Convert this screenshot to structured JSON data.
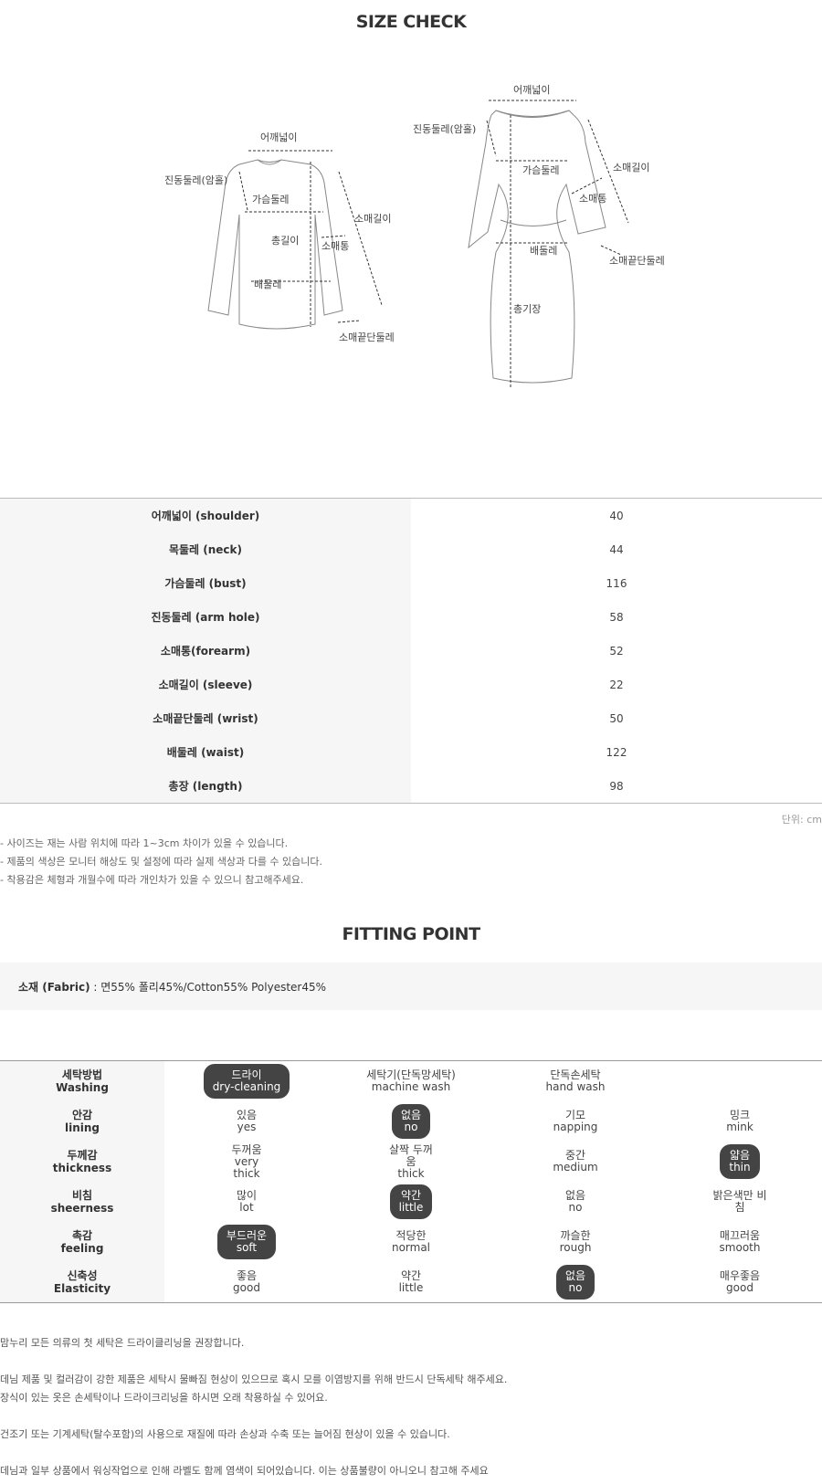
{
  "size_check": {
    "title": "SIZE CHECK",
    "top_diagram_labels": {
      "shoulder": "어깨넓이",
      "armhole": "진동둘레(암홀)",
      "bust": "가슴둘레",
      "length": "총길이",
      "forearm": "소매통",
      "sleeve": "소매길이",
      "waist": "배둘레",
      "wrist": "소매끝단둘레"
    },
    "dress_diagram_labels": {
      "shoulder": "어깨넓이",
      "armhole": "진동둘레(암홀)",
      "bust": "가슴둘레",
      "sleeve": "소매길이",
      "forearm": "소매통",
      "waist": "배둘레",
      "wrist": "소매끝단둘레",
      "length": "총기장"
    },
    "measurements": [
      {
        "label": "어깨넓이 (shoulder)",
        "value": "40"
      },
      {
        "label": "목둘레 (neck)",
        "value": "44"
      },
      {
        "label": "가슴둘레 (bust)",
        "value": "116"
      },
      {
        "label": "진동둘레 (arm hole)",
        "value": "58"
      },
      {
        "label": "소매통(forearm)",
        "value": "52"
      },
      {
        "label": "소매길이 (sleeve)",
        "value": "22"
      },
      {
        "label": "소매끝단둘레 (wrist)",
        "value": "50"
      },
      {
        "label": "배둘레 (waist)",
        "value": "122"
      },
      {
        "label": "총장 (length)",
        "value": "98"
      }
    ],
    "unit": "단위: cm",
    "notes": [
      "- 사이즈는 재는 사람 위치에 따라 1~3cm 차이가 있을 수 있습니다.",
      "- 제품의 색상은 모니터 해상도 및 설정에 따라 실제 색상과 다를 수 있습니다.",
      "- 착용감은 체형과 개월수에 따라 개인차가 있을 수 있으니 참고해주세요."
    ]
  },
  "fitting_point": {
    "title": "FITTING POINT",
    "fabric_label": "소재 (Fabric)",
    "fabric_value": " : 면55% 폴리45%/Cotton55% Polyester45%",
    "rows": [
      {
        "ko": "세탁방법",
        "en": "Washing",
        "options": [
          {
            "ko": "드라이",
            "en": "dry-cleaning",
            "selected": true
          },
          {
            "ko": "세탁기(단독망세탁)",
            "en": "machine wash",
            "selected": false
          },
          {
            "ko": "단독손세탁",
            "en": "hand wash",
            "selected": false
          },
          {
            "ko": "",
            "en": "",
            "selected": false
          }
        ]
      },
      {
        "ko": "안감",
        "en": "lining",
        "options": [
          {
            "ko": "있음",
            "en": "yes",
            "selected": false
          },
          {
            "ko": "없음",
            "en": "no",
            "selected": true
          },
          {
            "ko": "기모",
            "en": "napping",
            "selected": false
          },
          {
            "ko": "밍크",
            "en": "mink",
            "selected": false
          }
        ]
      },
      {
        "ko": "두께감",
        "en": "thickness",
        "options": [
          {
            "ko": "두꺼움",
            "en": "very\nthick",
            "selected": false
          },
          {
            "ko": "살짝 두꺼\n움",
            "en": "thick",
            "selected": false
          },
          {
            "ko": "중간",
            "en": "medium",
            "selected": false
          },
          {
            "ko": "얇음",
            "en": "thin",
            "selected": true
          }
        ]
      },
      {
        "ko": "비침",
        "en": "sheerness",
        "options": [
          {
            "ko": "많이",
            "en": "lot",
            "selected": false
          },
          {
            "ko": "약간",
            "en": "little",
            "selected": true
          },
          {
            "ko": "없음",
            "en": "no",
            "selected": false
          },
          {
            "ko": "밝은색만 비\n침",
            "en": "",
            "selected": false
          }
        ]
      },
      {
        "ko": "촉감",
        "en": "feeling",
        "options": [
          {
            "ko": "부드러운",
            "en": "soft",
            "selected": true
          },
          {
            "ko": "적당한",
            "en": "normal",
            "selected": false
          },
          {
            "ko": "까슬한",
            "en": "rough",
            "selected": false
          },
          {
            "ko": "매끄러움",
            "en": "smooth",
            "selected": false
          }
        ]
      },
      {
        "ko": "신축성",
        "en": "Elasticity",
        "options": [
          {
            "ko": "좋음",
            "en": "good",
            "selected": false
          },
          {
            "ko": "약간",
            "en": "little",
            "selected": false
          },
          {
            "ko": "없음",
            "en": "no",
            "selected": true
          },
          {
            "ko": "매우좋음",
            "en": "good",
            "selected": false
          }
        ]
      }
    ],
    "care_notes": [
      "맘누리 모든 의류의 첫 세탁은 드라이클리닝을 권장합니다.",
      "데님 제품 및 컬러감이 강한 제품은 세탁시 물빠짐 현상이 있으므로 혹시 모를 이염방지를 위해 반드시 단독세탁 해주세요.",
      "장식이 있는 옷은 손세탁이나 드라이크리닝을 하시면 오래 착용하실 수 있어요.",
      "건조기 또는 기계세탁(탈수포함)의 사용으로 재질에 따라 손상과 수축 또는 늘어짐 현상이 있을 수 있습니다.",
      "데님과 일부 상품에서 워싱작업으로 인해 라벨도 함께 염색이 되어있습니다. 이는 상품불량이 아니오니 참고해 주세요"
    ]
  }
}
